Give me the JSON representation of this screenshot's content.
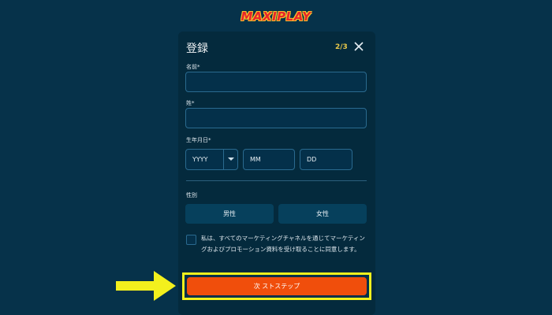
{
  "logo": {
    "text": "MAXIPLAY"
  },
  "modal": {
    "title": "登録",
    "step": "2/3",
    "close_icon": "close-icon"
  },
  "form": {
    "first_name_label": "名前*",
    "first_name_value": "",
    "last_name_label": "姓*",
    "last_name_value": "",
    "dob_label": "生年月日*",
    "dob_year": "YYYY",
    "dob_month": "MM",
    "dob_day": "DD",
    "gender_label": "性別",
    "gender_male": "男性",
    "gender_female": "女性",
    "consent_text": "私は、すべてのマーケティングチャネルを通じてマーケティングおよびプロモーション資料を受け取ることに同意します。",
    "submit_label": "次 ストステップ"
  },
  "colors": {
    "background": "#06324a",
    "modal": "#042a3d",
    "accent_orange": "#f04e0c",
    "highlight_yellow": "#f3f01d",
    "step_text": "#e8c84a"
  }
}
